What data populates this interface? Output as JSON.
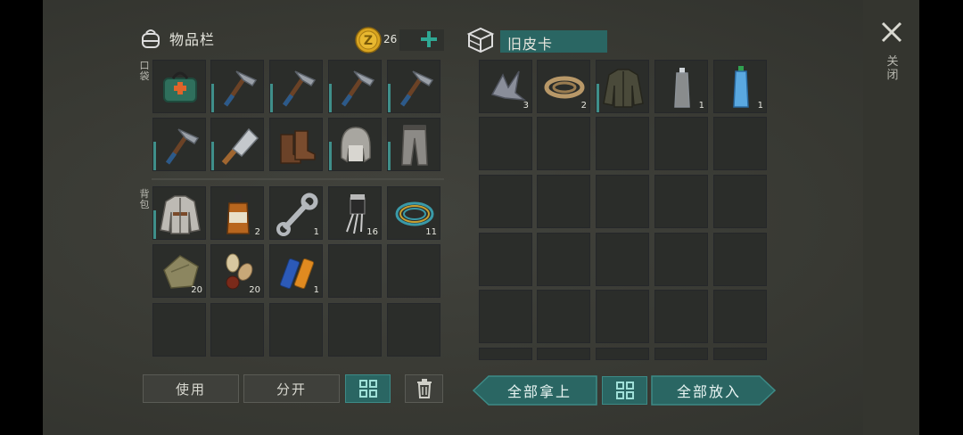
{
  "inventory": {
    "title": "物品栏",
    "coins": "26",
    "pocket_label": "口袋",
    "backpack_label": "背包",
    "pocket": [
      {
        "icon": "medkit-bag-icon",
        "count": ""
      },
      {
        "icon": "pickaxe-icon",
        "count": ""
      },
      {
        "icon": "pickaxe-icon",
        "count": ""
      },
      {
        "icon": "pickaxe-icon",
        "count": ""
      },
      {
        "icon": "pickaxe-icon",
        "count": ""
      },
      {
        "icon": "pickaxe-icon",
        "count": ""
      },
      {
        "icon": "cleaver-icon",
        "count": ""
      },
      {
        "icon": "boots-icon",
        "count": ""
      },
      {
        "icon": "fur-hat-icon",
        "count": ""
      },
      {
        "icon": "pants-icon",
        "count": ""
      }
    ],
    "backpack": [
      {
        "icon": "jacket-icon",
        "count": ""
      },
      {
        "icon": "whiskey-bottle-icon",
        "count": "2"
      },
      {
        "icon": "wrench-icon",
        "count": "1"
      },
      {
        "icon": "transistor-icon",
        "count": "16"
      },
      {
        "icon": "wire-coil-icon",
        "count": "11"
      },
      {
        "icon": "cloth-icon",
        "count": "20"
      },
      {
        "icon": "seeds-icon",
        "count": "20"
      },
      {
        "icon": "batteries-icon",
        "count": "1"
      },
      {
        "icon": "",
        "count": ""
      },
      {
        "icon": "",
        "count": ""
      },
      {
        "icon": "",
        "count": ""
      },
      {
        "icon": "",
        "count": ""
      },
      {
        "icon": "",
        "count": ""
      },
      {
        "icon": "",
        "count": ""
      },
      {
        "icon": "",
        "count": ""
      }
    ],
    "buttons": {
      "use": "使用",
      "split": "分开"
    }
  },
  "container": {
    "title": "旧皮卡",
    "items": [
      {
        "icon": "scrap-metal-icon",
        "count": "3"
      },
      {
        "icon": "rope-icon",
        "count": "2"
      },
      {
        "icon": "leather-jacket-icon",
        "count": ""
      },
      {
        "icon": "empty-bottle-icon",
        "count": "1"
      },
      {
        "icon": "water-bottle-icon",
        "count": "1"
      }
    ],
    "buttons": {
      "take_all": "全部拿上",
      "put_all": "全部放入"
    }
  },
  "close_label": "关闭",
  "colors": {
    "accent": "#2a6663",
    "background": "#3a3b36",
    "slot": "#2b2d2a"
  }
}
